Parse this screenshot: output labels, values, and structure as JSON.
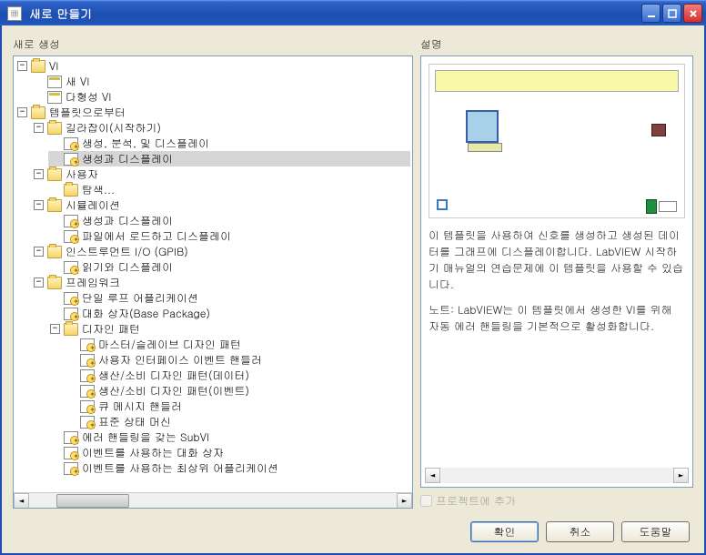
{
  "window": {
    "title": "새로 만들기",
    "icon_glyph": "▦"
  },
  "left": {
    "label": "새로 생성"
  },
  "right": {
    "label": "설명",
    "description_p1": "이 템플릿을 사용하여 신호를 생성하고 생성된 데이터를 그래프에 디스플레이합니다. LabVIEW 시작하기 매뉴얼의 연습문제에 이 템플릿을 사용할 수 있습니다.",
    "description_p2": "노트: LabVIEW는 이 템플릿에서 생성한 VI를 위해 자동 에러 핸들링을 기본적으로 활성화합니다.",
    "checkbox_label": "프로젝트에 추가",
    "checkbox_checked": false,
    "checkbox_enabled": false
  },
  "buttons": {
    "ok": "확인",
    "cancel": "취소",
    "help": "도움말"
  },
  "tree": [
    {
      "depth": 0,
      "exp": "-",
      "icon": "folder",
      "label": "VI"
    },
    {
      "depth": 1,
      "exp": "",
      "icon": "vi",
      "label": "새 VI"
    },
    {
      "depth": 1,
      "exp": "",
      "icon": "vi",
      "label": "다형성 VI"
    },
    {
      "depth": 0,
      "exp": "-",
      "icon": "folder",
      "label": "템플릿으로부터"
    },
    {
      "depth": 1,
      "exp": "-",
      "icon": "folder",
      "label": "길라잡이(시작하기)"
    },
    {
      "depth": 2,
      "exp": "",
      "icon": "template",
      "label": "생성, 분석, 및 디스플레이"
    },
    {
      "depth": 2,
      "exp": "",
      "icon": "template",
      "label": "생성과 디스플레이",
      "selected": true
    },
    {
      "depth": 1,
      "exp": "-",
      "icon": "folder",
      "label": "사용자"
    },
    {
      "depth": 2,
      "exp": "",
      "icon": "folder",
      "label": "탐색..."
    },
    {
      "depth": 1,
      "exp": "-",
      "icon": "folder",
      "label": "시뮬레이션"
    },
    {
      "depth": 2,
      "exp": "",
      "icon": "template",
      "label": "생성과 디스플레이"
    },
    {
      "depth": 2,
      "exp": "",
      "icon": "template",
      "label": "파일에서 로드하고 디스플레이"
    },
    {
      "depth": 1,
      "exp": "-",
      "icon": "folder",
      "label": "인스트루먼트 I/O (GPIB)"
    },
    {
      "depth": 2,
      "exp": "",
      "icon": "template",
      "label": "읽기와 디스플레이"
    },
    {
      "depth": 1,
      "exp": "-",
      "icon": "folder",
      "label": "프레임워크"
    },
    {
      "depth": 2,
      "exp": "",
      "icon": "template",
      "label": "단일 루프 어플리케이션"
    },
    {
      "depth": 2,
      "exp": "",
      "icon": "template",
      "label": "대화 상자(Base Package)"
    },
    {
      "depth": 2,
      "exp": "-",
      "icon": "folder",
      "label": "디자인 패턴"
    },
    {
      "depth": 3,
      "exp": "",
      "icon": "template",
      "label": "마스터/슬레이브 디자인 패턴"
    },
    {
      "depth": 3,
      "exp": "",
      "icon": "template",
      "label": "사용자 인터페이스 이벤트 핸들러"
    },
    {
      "depth": 3,
      "exp": "",
      "icon": "template",
      "label": "생산/소비 디자인 패턴(데이터)"
    },
    {
      "depth": 3,
      "exp": "",
      "icon": "template",
      "label": "생산/소비 디자인 패턴(이벤트)"
    },
    {
      "depth": 3,
      "exp": "",
      "icon": "template",
      "label": "큐 메시지 핸들러"
    },
    {
      "depth": 3,
      "exp": "",
      "icon": "template",
      "label": "표준 상태 머신"
    },
    {
      "depth": 2,
      "exp": "",
      "icon": "template",
      "label": "에러 핸들링을 갖는 SubVI"
    },
    {
      "depth": 2,
      "exp": "",
      "icon": "template",
      "label": "이벤트를 사용하는 대화 상자"
    },
    {
      "depth": 2,
      "exp": "",
      "icon": "template",
      "label": "이벤트를 사용하는 최상위 어플리케이션"
    }
  ]
}
